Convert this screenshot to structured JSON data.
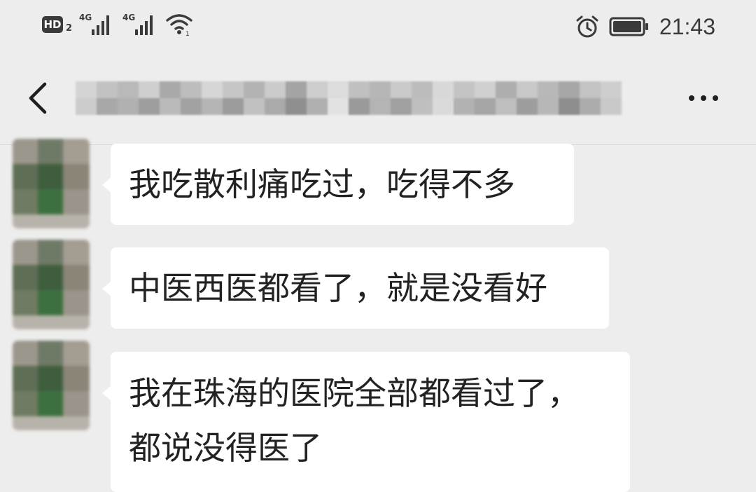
{
  "status_bar": {
    "hd_label": "HD",
    "hd_sub": "2",
    "network_1": "4G",
    "network_2": "4G",
    "time": "21:43",
    "icons": [
      "signal-icon",
      "signal-icon",
      "wifi-icon",
      "alarm-icon",
      "battery-icon"
    ]
  },
  "header": {
    "back_icon": "chevron-left-icon",
    "title": "",
    "more_icon": "more-horizontal-icon"
  },
  "messages": [
    {
      "sender": "received",
      "lines": [
        "我吃散利痛吃过，吃得不多"
      ]
    },
    {
      "sender": "received",
      "lines": [
        "中医西医都看了，就是没看好"
      ]
    },
    {
      "sender": "received",
      "lines": [
        "我在珠海的医院全部都看过了，",
        "都说没得医了"
      ]
    }
  ],
  "colors": {
    "background": "#ededed",
    "bubble": "#ffffff",
    "text": "#222222",
    "status_icon": "#3a3a3a"
  }
}
